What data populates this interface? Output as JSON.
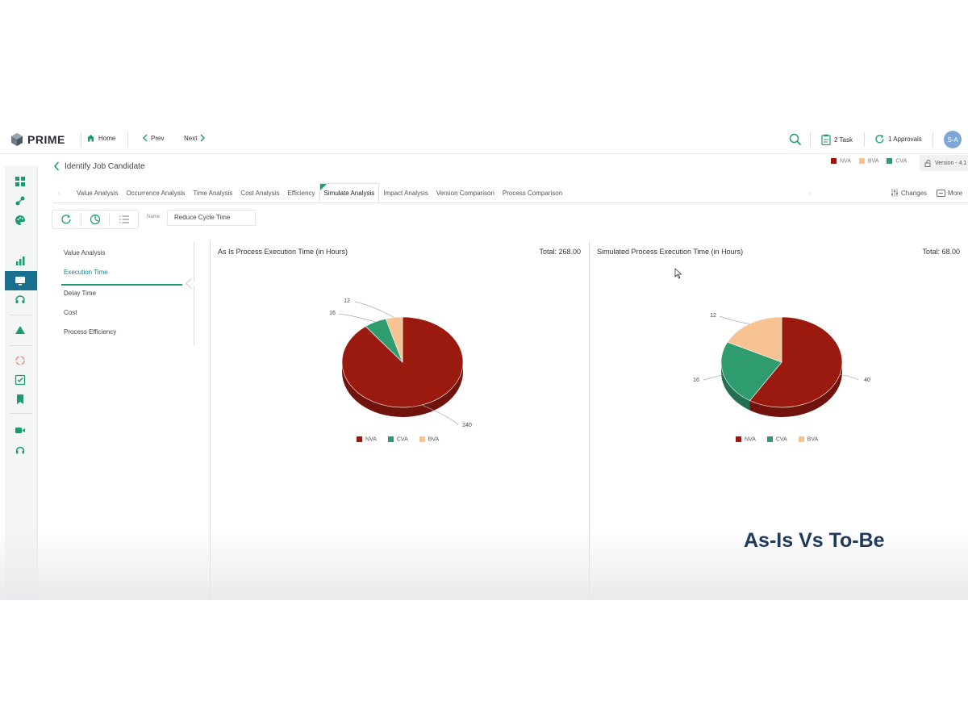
{
  "topbar": {
    "logo": "PRIME",
    "home": "Home",
    "prev": "Prev",
    "next": "Next",
    "tasks": "2 Task",
    "approvals": "1 Approvals",
    "avatar": "S-A"
  },
  "page": {
    "title": "Identify Job Candidate",
    "version": "Version - 4.1"
  },
  "legend_top": [
    {
      "label": "NVA",
      "color": "#9b1a10"
    },
    {
      "label": "BVA",
      "color": "#f7c392"
    },
    {
      "label": "CVA",
      "color": "#2f9c6f"
    }
  ],
  "tabs": [
    {
      "label": "Value Analysis"
    },
    {
      "label": "Occurrence Analysis"
    },
    {
      "label": "Time Analysis"
    },
    {
      "label": "Cost Analysis"
    },
    {
      "label": "Efficiency"
    },
    {
      "label": "Simulate Analysis"
    },
    {
      "label": "Impact Analysis"
    },
    {
      "label": "Version Comparison"
    },
    {
      "label": "Process Comparison"
    }
  ],
  "active_tab": "Simulate Analysis",
  "tools": {
    "changes": "Changes",
    "more": "More"
  },
  "toolbar": {
    "name_label": "Name",
    "name_value": "Reduce Cycle Time"
  },
  "metrics": [
    {
      "label": "Value Analysis"
    },
    {
      "label": "Execution Time"
    },
    {
      "label": "Delay Time"
    },
    {
      "label": "Cost"
    },
    {
      "label": "Process Efficiency"
    }
  ],
  "active_metric": "Execution Time",
  "chart_data": [
    {
      "type": "pie",
      "title": "As Is Process Execution Time (in Hours)",
      "total": "Total: 268.00",
      "categories": [
        "NVA",
        "CVA",
        "BVA"
      ],
      "values": [
        240,
        16,
        12
      ],
      "colors": [
        "#9b1a10",
        "#2f9c6f",
        "#f7c392"
      ]
    },
    {
      "type": "pie",
      "title": "Simulated Process Execution Time (in Hours)",
      "total": "Total: 68.00",
      "categories": [
        "NVA",
        "CVA",
        "BVA"
      ],
      "values": [
        40,
        16,
        12
      ],
      "colors": [
        "#9b1a10",
        "#2f9c6f",
        "#f7c392"
      ]
    }
  ],
  "overlay": "As-Is Vs To-Be"
}
